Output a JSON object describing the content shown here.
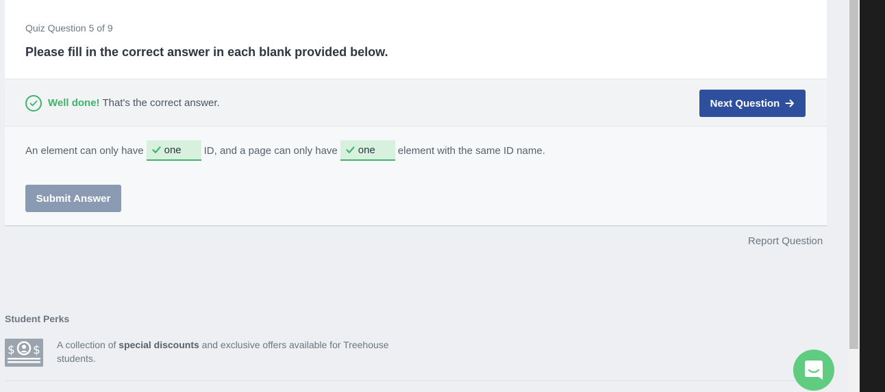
{
  "quiz": {
    "counter": "Quiz Question 5 of 9",
    "title": "Please fill in the correct answer in each blank provided below."
  },
  "feedback": {
    "strong": "Well done!",
    "message": " That's the correct answer.",
    "next_label": "Next Question"
  },
  "question": {
    "part1": "An element can only have",
    "blank1": "one",
    "part2": "ID, and a page can only have",
    "blank2": "one",
    "part3": "element with the same ID name."
  },
  "submit_label": "Submit Answer",
  "report_label": "Report Question",
  "perks": {
    "title": "Student Perks",
    "text_before": "A collection of ",
    "text_strong": "special discounts",
    "text_after": " and exclusive offers available for Treehouse students."
  },
  "colors": {
    "success": "#3fb36a",
    "primary": "#2d4f9e",
    "disabled": "#8b9ab3",
    "chat": "#5fcc7f"
  },
  "icons": [
    "check-circle-icon",
    "arrow-right-icon",
    "checkmark-icon",
    "perks-money-icon",
    "chat-icon"
  ]
}
